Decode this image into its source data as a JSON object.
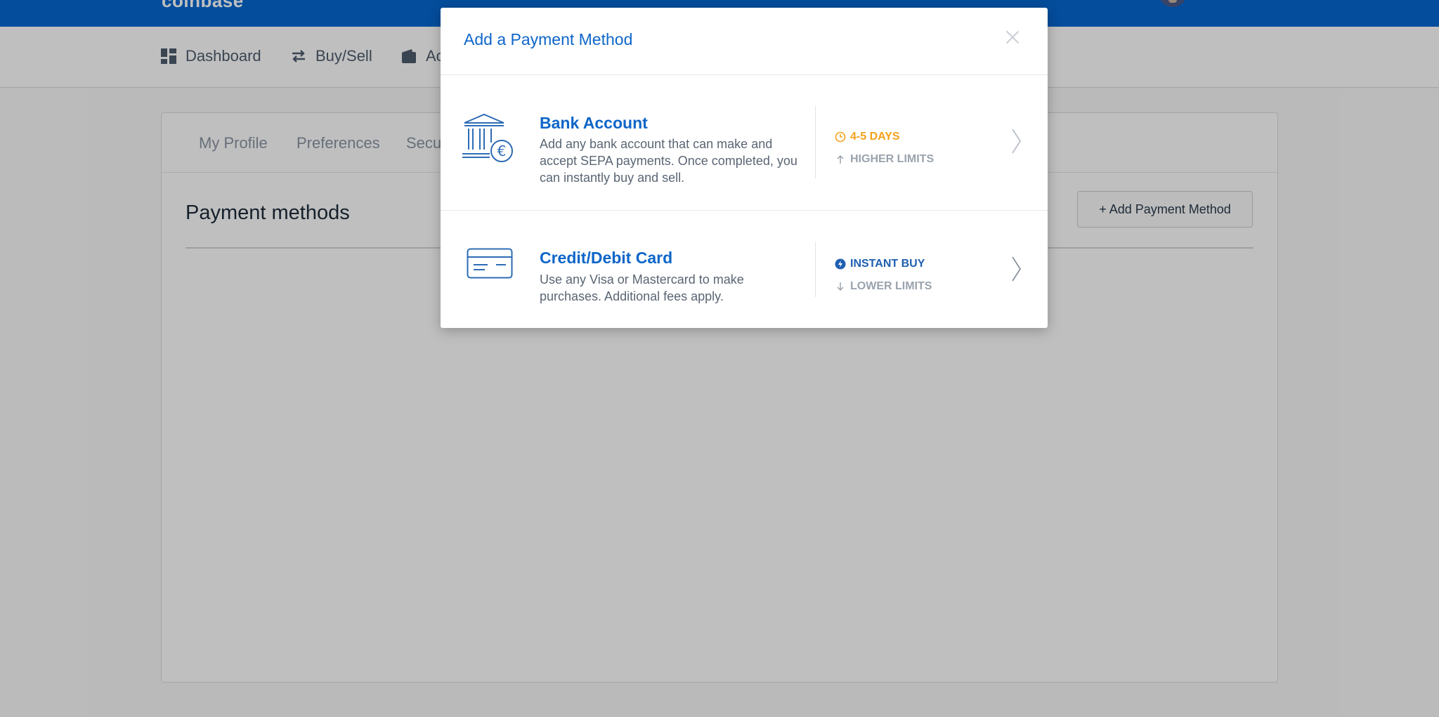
{
  "app": {
    "logo_fragment": "coinbase"
  },
  "nav": {
    "items": [
      {
        "label": "Dashboard",
        "icon": "dashboard-icon"
      },
      {
        "label": "Buy/Sell",
        "icon": "swap-icon"
      },
      {
        "label": "Ac",
        "icon": "wallet-icon"
      }
    ]
  },
  "settings": {
    "tabs": [
      "My Profile",
      "Preferences",
      "Secu"
    ],
    "section_title": "Payment methods",
    "add_button": "+ Add Payment Method"
  },
  "modal": {
    "title": "Add a Payment Method",
    "options": [
      {
        "name": "Bank Account",
        "description": "Add any bank account that can make and accept SEPA payments. Once completed, you can instantly buy and sell.",
        "icon": "bank-euro-icon",
        "speed": "4-5 DAYS",
        "speed_icon": "clock-icon",
        "limits": "HIGHER LIMITS",
        "limits_icon": "arrow-up-icon"
      },
      {
        "name": "Credit/Debit Card",
        "description": "Use any Visa or Mastercard to make purchases. Additional fees apply.",
        "icon": "credit-card-icon",
        "speed": "INSTANT BUY",
        "speed_icon": "lightning-icon",
        "limits": "LOWER LIMITS",
        "limits_icon": "arrow-down-icon"
      }
    ]
  },
  "colors": {
    "brand_blue": "#0667d0",
    "link_blue": "#0e66c8",
    "warning_orange": "#f4a11b"
  }
}
